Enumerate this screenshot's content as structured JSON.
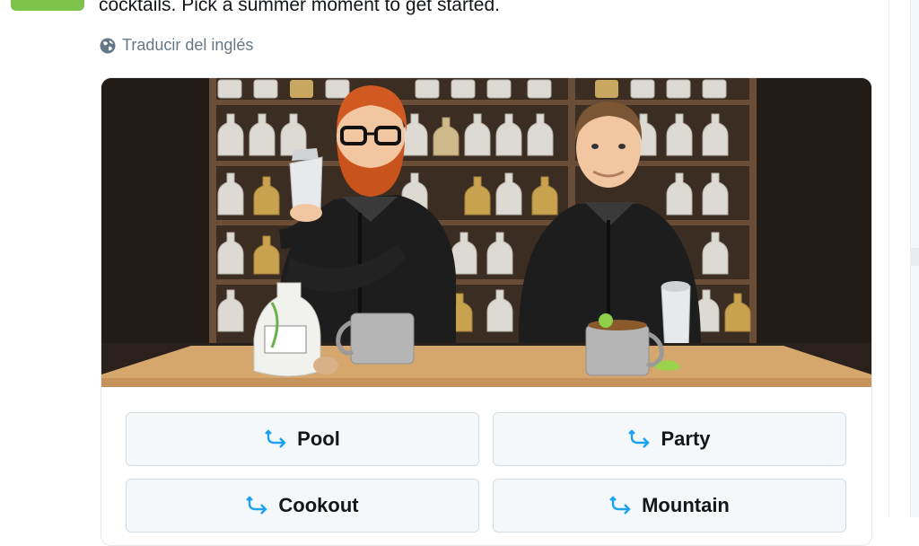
{
  "tweet": {
    "text": "cocktails. Pick a summer moment to get started.",
    "translate_label": "Traducir del inglés"
  },
  "card": {
    "image": "Two cartoon bartenders behind a wooden bar with tequila bottles on shelves",
    "options": [
      {
        "label": "Pool",
        "icon": "reply-arrow-icon"
      },
      {
        "label": "Party",
        "icon": "reply-arrow-icon"
      },
      {
        "label": "Cookout",
        "icon": "reply-arrow-icon"
      },
      {
        "label": "Mountain",
        "icon": "reply-arrow-icon"
      }
    ]
  },
  "colors": {
    "accent": "#1da1f2",
    "text": "#14171a",
    "muted": "#657786",
    "green": "#7dc24b"
  }
}
